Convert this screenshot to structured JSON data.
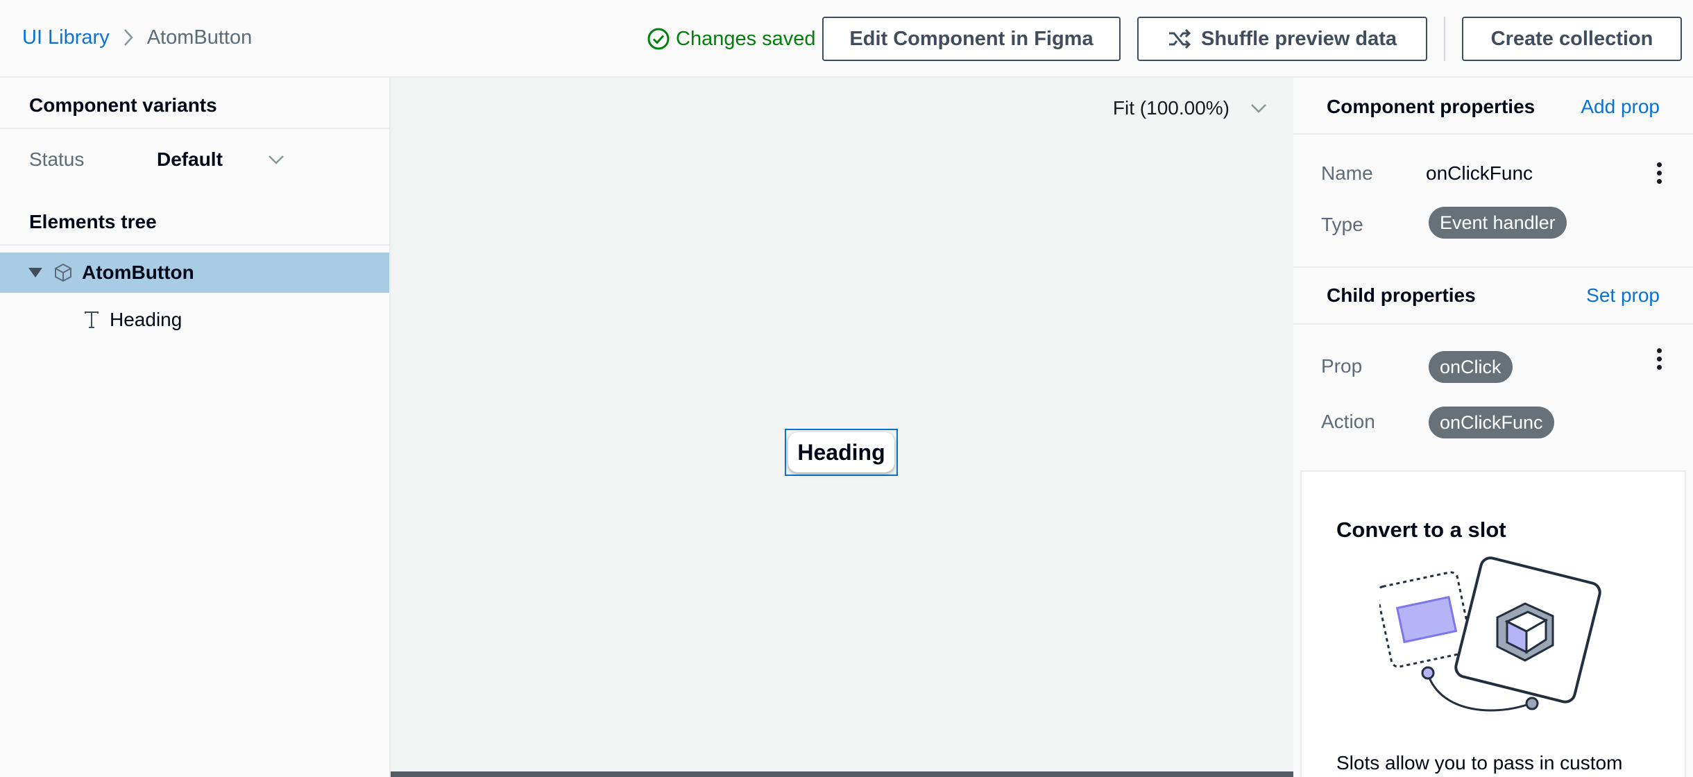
{
  "breadcrumb": {
    "root": "UI Library",
    "current": "AtomButton"
  },
  "header": {
    "saved_status": "Changes saved",
    "edit_figma_label": "Edit Component in Figma",
    "shuffle_label": "Shuffle preview data",
    "create_collection_label": "Create collection"
  },
  "left_panel": {
    "variants_title": "Component variants",
    "status_label": "Status",
    "status_value": "Default",
    "tree_title": "Elements tree",
    "tree": [
      {
        "label": "AtomButton",
        "icon": "cube-icon",
        "selected": true
      },
      {
        "label": "Heading",
        "icon": "text-icon",
        "selected": false
      }
    ]
  },
  "canvas": {
    "zoom_label": "Fit (100.00%)",
    "preview_label": "Heading"
  },
  "component_properties": {
    "title": "Component properties",
    "add_link": "Add prop",
    "name_key": "Name",
    "name_value": "onClickFunc",
    "type_key": "Type",
    "type_value": "Event handler"
  },
  "child_properties": {
    "title": "Child properties",
    "set_link": "Set prop",
    "prop_key": "Prop",
    "prop_value": "onClick",
    "action_key": "Action",
    "action_value": "onClickFunc"
  },
  "slot_card": {
    "title": "Convert to a slot",
    "text": "Slots allow you to pass in custom"
  },
  "colors": {
    "link": "#0972d3",
    "success": "#037f0c",
    "selected_row": "#a8cce4",
    "pill": "#687078",
    "slot_accent": "#b6b4f6"
  }
}
